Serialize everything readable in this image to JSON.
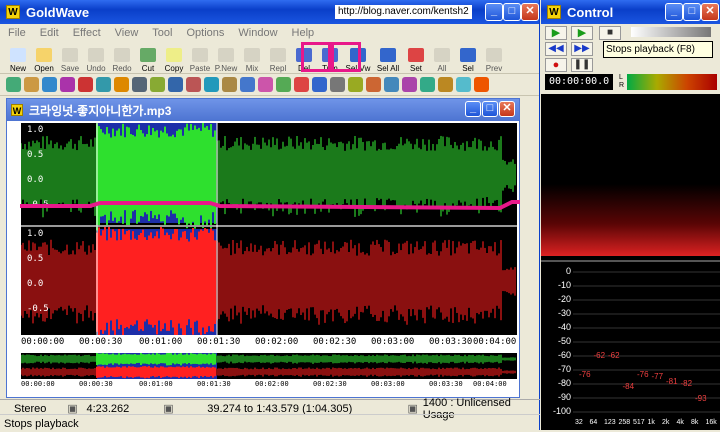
{
  "goldwave": {
    "title": "GoldWave",
    "url_overlay": "http://blog.naver.com/kentsh2",
    "menu": [
      "File",
      "Edit",
      "Effect",
      "View",
      "Tool",
      "Options",
      "Window",
      "Help"
    ],
    "toolbar": [
      {
        "label": "New",
        "active": true
      },
      {
        "label": "Open",
        "active": true
      },
      {
        "label": "Save",
        "active": false
      },
      {
        "label": "Undo",
        "active": false
      },
      {
        "label": "Redo",
        "active": false
      },
      {
        "label": "Cut",
        "active": true
      },
      {
        "label": "Copy",
        "active": true
      },
      {
        "label": "Paste",
        "active": false
      },
      {
        "label": "P.New",
        "active": false
      },
      {
        "label": "Mix",
        "active": false
      },
      {
        "label": "Repl",
        "active": false
      },
      {
        "label": "Del",
        "active": true
      },
      {
        "label": "Trim",
        "active": true
      },
      {
        "label": "Sel Vw",
        "active": true
      },
      {
        "label": "Sel All",
        "active": true
      },
      {
        "label": "Set",
        "active": true
      },
      {
        "label": "All",
        "active": false
      },
      {
        "label": "Sel",
        "active": true
      },
      {
        "label": "Prev",
        "active": false
      }
    ],
    "document": {
      "title": "크라잉넛-좋지아니한가.mp3",
      "left_labels": [
        "1.0",
        "0.5",
        "0.0",
        "-0.5"
      ],
      "right_labels": [
        "1.0",
        "0.5",
        "0.0",
        "-0.5"
      ],
      "timeline": [
        "00:00:00",
        "00:00:30",
        "00:01:00",
        "00:01:30",
        "00:02:00",
        "00:02:30",
        "00:03:00",
        "00:03:30",
        "00:04:00"
      ],
      "overview_timeline": [
        "00:00:00",
        "00:00:30",
        "00:01:00",
        "00:01:30",
        "00:02:00",
        "00:02:30",
        "00:03:00",
        "00:03:30",
        "00:04:00"
      ]
    },
    "status": {
      "channels": "Stereo",
      "length": "4:23.262",
      "selection": "39.274 to 1:43.579 (1:04.305)",
      "usage": "1400 : Unlicensed Usage",
      "message": "Stops playback"
    }
  },
  "control": {
    "title": "Control",
    "tooltip": "Stops playback (F8)",
    "time": "00:00:00.0",
    "meter_channels": [
      "L",
      "R"
    ],
    "db_labels": [
      "0",
      "-10",
      "-20",
      "-30",
      "-40",
      "-50",
      "-60",
      "-70",
      "-80",
      "-90",
      "-100"
    ],
    "freq_labels": [
      "32",
      "64",
      "123",
      "258",
      "517",
      "1k",
      "2k",
      "4k",
      "8k",
      "16k"
    ],
    "peaks": [
      "-76",
      "-62",
      "-62",
      "-84",
      "-76",
      "-77",
      "-81",
      "-82",
      "-93"
    ]
  },
  "colors": {
    "highlight": "#e8188a",
    "left_wave": "#2ee02e",
    "right_wave": "#ff2020",
    "selection_bg": "#1d2ea8"
  }
}
